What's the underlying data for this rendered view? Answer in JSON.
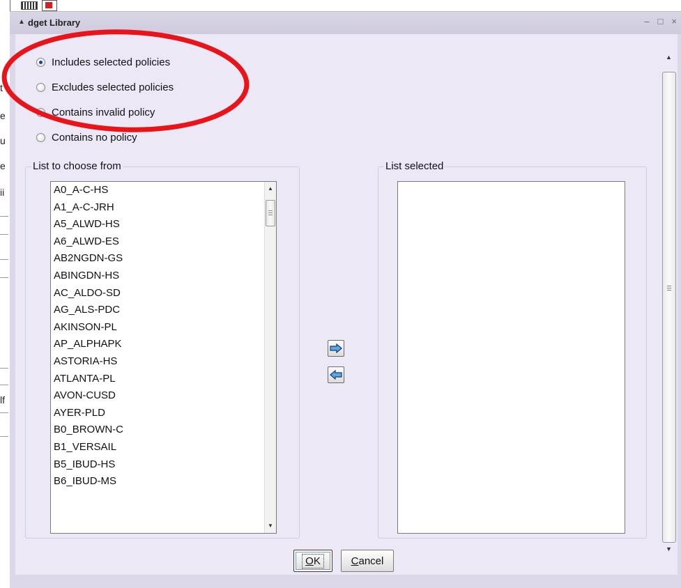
{
  "window": {
    "title": "dget Library",
    "controls": {
      "minimize": "–",
      "maximize": "□",
      "close": "×"
    }
  },
  "background_fragments": [
    "t",
    "e",
    "u",
    "e",
    "ii",
    "lf"
  ],
  "filter_options": [
    {
      "label": "Includes selected policies",
      "checked": true
    },
    {
      "label": "Excludes selected policies",
      "checked": false
    },
    {
      "label": "Contains invalid policy",
      "checked": false
    },
    {
      "label": "Contains no policy",
      "checked": false
    }
  ],
  "list_choose": {
    "label": "List to choose from",
    "items": [
      "A0_A-C-HS",
      "A1_A-C-JRH",
      "A5_ALWD-HS",
      "A6_ALWD-ES",
      "AB2NGDN-GS",
      "ABINGDN-HS",
      "AC_ALDO-SD",
      "AG_ALS-PDC",
      "AKINSON-PL",
      "AP_ALPHAPK",
      "ASTORIA-HS",
      "ATLANTA-PL",
      "AVON-CUSD",
      "AYER-PLD",
      "B0_BROWN-C",
      "B1_VERSAIL",
      "B5_IBUD-HS",
      "B6_IBUD-MS"
    ]
  },
  "list_selected": {
    "label": "List selected",
    "items": []
  },
  "move_buttons": {
    "add_icon": "arrow-right-icon",
    "remove_icon": "arrow-left-icon"
  },
  "buttons": {
    "ok": "OK",
    "cancel": "Cancel"
  },
  "colors": {
    "dialog_bg": "#ece8f6",
    "annotation": "#e8141a",
    "arrow_fill": "#5aa8e8"
  }
}
